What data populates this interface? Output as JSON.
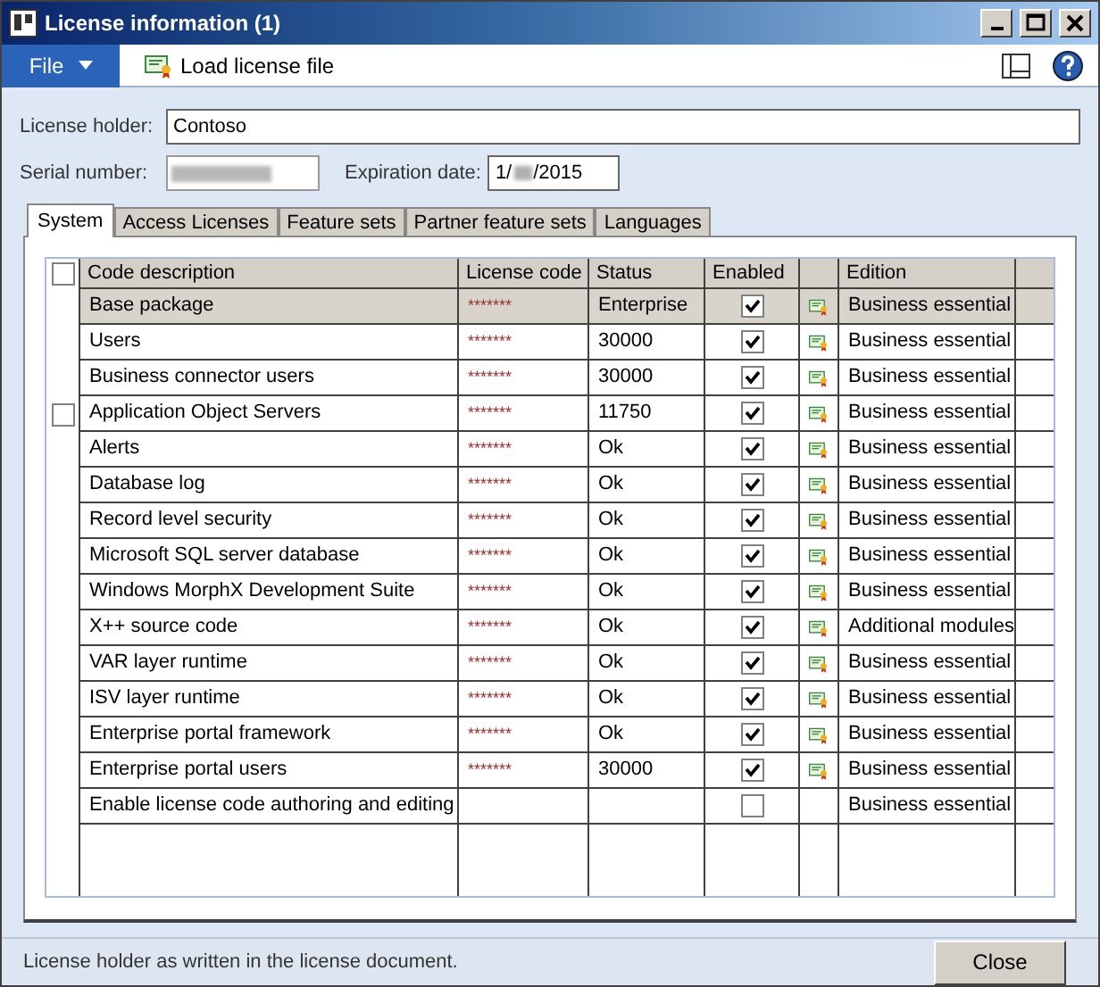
{
  "window": {
    "title": "License information (1)"
  },
  "toolbar": {
    "file_menu": "File",
    "load_button": "Load license file"
  },
  "form": {
    "license_holder": {
      "label": "License holder:",
      "value": "Contoso"
    },
    "serial_number": {
      "label": "Serial number:",
      "redacted": true
    },
    "expiration_date": {
      "label": "Expiration date:",
      "value_start": "1/",
      "value_end": "/2015"
    }
  },
  "tabs": [
    {
      "label": "System",
      "selected": true
    },
    {
      "label": "Access Licenses",
      "selected": false
    },
    {
      "label": "Feature sets",
      "selected": false
    },
    {
      "label": "Partner feature sets",
      "selected": false
    },
    {
      "label": "Languages",
      "selected": false
    }
  ],
  "table": {
    "header_checked": false,
    "columns": [
      "Code description",
      "License code",
      "Status",
      "Enabled",
      "Edition"
    ],
    "rows": [
      {
        "description": "Base package",
        "code": "*******",
        "status": "Enterprise",
        "enabled": true,
        "certificate": true,
        "edition": "Business essential",
        "selected": true
      },
      {
        "description": "Users",
        "code": "*******",
        "status": "30000",
        "enabled": true,
        "certificate": true,
        "edition": "Business essential",
        "selected": false
      },
      {
        "description": "Business connector users",
        "code": "*******",
        "status": "30000",
        "enabled": true,
        "certificate": true,
        "edition": "Business essential",
        "selected": false
      },
      {
        "description": "Application Object Servers",
        "code": "*******",
        "status": "11750",
        "enabled": true,
        "certificate": true,
        "edition": "Business essential",
        "selected": false,
        "marked": false
      },
      {
        "description": "Alerts",
        "code": "*******",
        "status": "Ok",
        "enabled": true,
        "certificate": true,
        "edition": "Business essential",
        "selected": false
      },
      {
        "description": "Database log",
        "code": "*******",
        "status": "Ok",
        "enabled": true,
        "certificate": true,
        "edition": "Business essential",
        "selected": false
      },
      {
        "description": "Record level security",
        "code": "*******",
        "status": "Ok",
        "enabled": true,
        "certificate": true,
        "edition": "Business essential",
        "selected": false
      },
      {
        "description": "Microsoft SQL server database",
        "code": "*******",
        "status": "Ok",
        "enabled": true,
        "certificate": true,
        "edition": "Business essential",
        "selected": false
      },
      {
        "description": "Windows MorphX Development Suite",
        "code": "*******",
        "status": "Ok",
        "enabled": true,
        "certificate": true,
        "edition": "Business essential",
        "selected": false
      },
      {
        "description": "X++ source code",
        "code": "*******",
        "status": "Ok",
        "enabled": true,
        "certificate": true,
        "edition": "Additional modules",
        "selected": false
      },
      {
        "description": "VAR layer runtime",
        "code": "*******",
        "status": "Ok",
        "enabled": true,
        "certificate": true,
        "edition": "Business essential",
        "selected": false
      },
      {
        "description": "ISV layer runtime",
        "code": "*******",
        "status": "Ok",
        "enabled": true,
        "certificate": true,
        "edition": "Business essential",
        "selected": false
      },
      {
        "description": "Enterprise portal framework",
        "code": "*******",
        "status": "Ok",
        "enabled": true,
        "certificate": true,
        "edition": "Business essential",
        "selected": false
      },
      {
        "description": "Enterprise portal users",
        "code": "*******",
        "status": "30000",
        "enabled": true,
        "certificate": true,
        "edition": "Business essential",
        "selected": false
      },
      {
        "description": "Enable license code authoring and editing",
        "enabled": false,
        "certificate": false,
        "edition": "Business essential",
        "selected": false
      }
    ]
  },
  "status_bar": {
    "help_text": "License holder as written in the license document.",
    "close_button": "Close"
  }
}
